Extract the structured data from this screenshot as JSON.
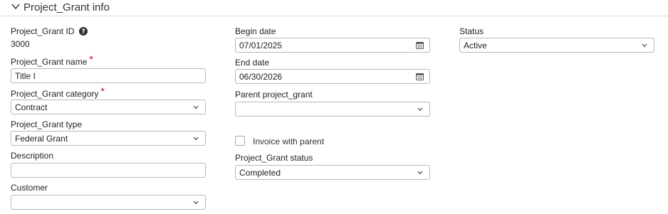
{
  "section": {
    "title": "Project_Grant info"
  },
  "fields": {
    "project_grant_id": {
      "label": "Project_Grant ID",
      "value": "3000"
    },
    "project_grant_name": {
      "label": "Project_Grant name",
      "required_mark": "*",
      "value": "Title I"
    },
    "project_grant_category": {
      "label": "Project_Grant category",
      "required_mark": "*",
      "value": "Contract"
    },
    "project_grant_type": {
      "label": "Project_Grant type",
      "value": "Federal Grant"
    },
    "description": {
      "label": "Description",
      "value": ""
    },
    "customer": {
      "label": "Customer",
      "value": ""
    },
    "begin_date": {
      "label": "Begin date",
      "value": "07/01/2025"
    },
    "end_date": {
      "label": "End date",
      "value": "06/30/2026"
    },
    "parent_project_grant": {
      "label": "Parent project_grant",
      "value": ""
    },
    "invoice_with_parent": {
      "label": "Invoice with parent",
      "checked": false
    },
    "project_grant_status": {
      "label": "Project_Grant status",
      "value": "Completed"
    },
    "status": {
      "label": "Status",
      "value": "Active"
    }
  },
  "icons": {
    "section_toggle": "chevron-down-icon",
    "help": "question-circle-icon",
    "calendar": "calendar-icon",
    "dropdown": "chevron-down-icon"
  },
  "colors": {
    "required": "#d0021b",
    "border": "#b9b9b9"
  }
}
